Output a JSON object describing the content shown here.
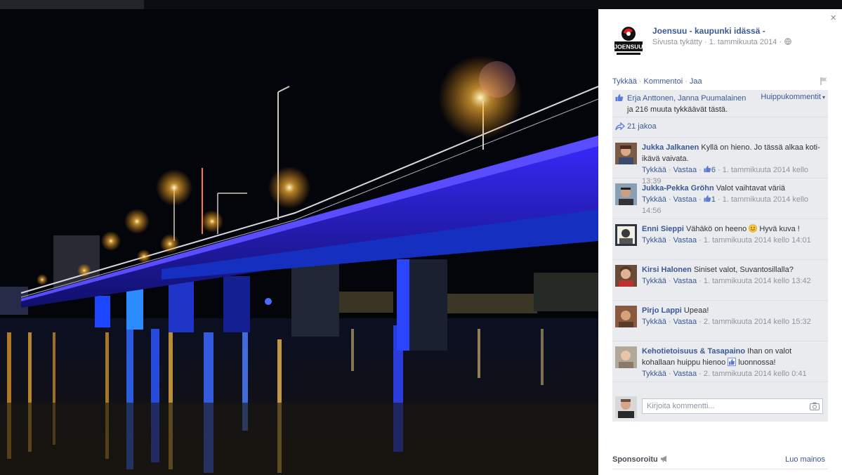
{
  "page": {
    "name": "Joensuu - kaupunki idässä -",
    "meta": "Sivusta tykätty · 1. tammikuuta 2014 ·",
    "logo_text": "JOENSUU"
  },
  "actions": {
    "like": "Tykkää",
    "comment": "Kommentoi",
    "share": "Jaa"
  },
  "likes": {
    "names": "Erja Anttonen, Janna Puumalainen",
    "rest": " ja 216 muuta tykkäävät tästä.",
    "top_comments": "Huippukommentit"
  },
  "shares": "21 jakoa",
  "comments": [
    {
      "author": "Jukka Jalkanen",
      "text": "Kyllä on hieno. Jo tässä alkaa koti-ikävä vaivata.",
      "like": "Tykkää",
      "reply": "Vastaa",
      "likes": "6",
      "time": "1. tammikuuta 2014 kello 13:39"
    },
    {
      "author": "Jukka-Pekka Gröhn",
      "text": "Valot vaihtavat väriä",
      "like": "Tykkää",
      "reply": "Vastaa",
      "likes": "1",
      "time": "1. tammikuuta 2014 kello 14:56"
    },
    {
      "author": "Enni Sieppi",
      "text_before": "Vähäkö on heeno",
      "text_after": "Hyvä kuva !",
      "like": "Tykkää",
      "reply": "Vastaa",
      "time": "1. tammikuuta 2014 kello 14:01"
    },
    {
      "author": "Kirsi Halonen",
      "text": "Siniset valot, Suvantosillalla?",
      "like": "Tykkää",
      "reply": "Vastaa",
      "time": "1. tammikuuta 2014 kello 13:42"
    },
    {
      "author": "Pirjo Lappi",
      "text": "Upeaa!",
      "like": "Tykkää",
      "reply": "Vastaa",
      "time": "2. tammikuuta 2014 kello 15:32"
    },
    {
      "author": "Kehotietoisuus & Tasapaino",
      "text_before": "Ihan on valot kohallaan huippu hienoo",
      "text_after": "luonnossa!",
      "like": "Tykkää",
      "reply": "Vastaa",
      "time": "2. tammikuuta 2014 kello 0:41"
    }
  ],
  "write_placeholder": "Kirjoita kommentti...",
  "sponsored": "Sponsoroitu",
  "create_ad": "Luo mainos",
  "close": "×"
}
